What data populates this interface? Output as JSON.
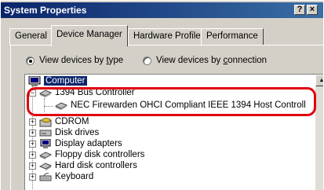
{
  "window": {
    "title": "System Properties",
    "help_btn": "?",
    "close_btn": "×"
  },
  "tabs": [
    {
      "label": "General"
    },
    {
      "label": "Device Manager"
    },
    {
      "label": "Hardware Profiles"
    },
    {
      "label": "Performance"
    }
  ],
  "view": {
    "by_type_pre": "View devices by ",
    "by_type_u": "t",
    "by_type_post": "ype",
    "by_conn_pre": "View devices by ",
    "by_conn_u": "c",
    "by_conn_post": "onnection",
    "selected": "by_type"
  },
  "tree": {
    "root": "Computer",
    "items": [
      {
        "label": "1394 Bus Controller",
        "icon": "bus-controller-icon",
        "state": "expanded"
      },
      {
        "label": "NEC Firewarden OHCI Compliant IEEE 1394 Host Controll",
        "icon": "host-controller-icon",
        "state": "child"
      },
      {
        "label": "CDROM",
        "icon": "cdrom-icon",
        "state": "collapsed"
      },
      {
        "label": "Disk drives",
        "icon": "disk-drive-icon",
        "state": "collapsed"
      },
      {
        "label": "Display adapters",
        "icon": "monitor-icon",
        "state": "collapsed"
      },
      {
        "label": "Floppy disk controllers",
        "icon": "floppy-controller-icon",
        "state": "collapsed"
      },
      {
        "label": "Hard disk controllers",
        "icon": "hard-disk-controller-icon",
        "state": "collapsed"
      },
      {
        "label": "Keyboard",
        "icon": "keyboard-icon",
        "state": "collapsed"
      }
    ]
  },
  "colors": {
    "highlight": "#0a246a",
    "callout": "#e0000e",
    "titlebar": "#0a246a"
  }
}
